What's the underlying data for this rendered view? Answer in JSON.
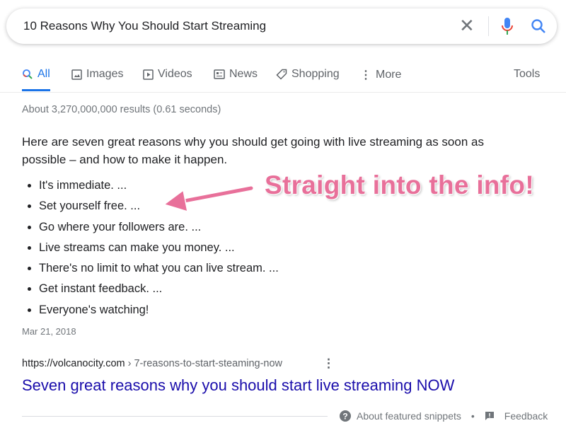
{
  "search": {
    "query": "10 Reasons Why You Should Start Streaming",
    "clear_icon": "close-icon",
    "voice_icon": "mic-icon",
    "search_icon": "search-icon"
  },
  "tabs": [
    {
      "label": "All",
      "icon": "search-icon",
      "active": true
    },
    {
      "label": "Images",
      "icon": "image-icon"
    },
    {
      "label": "Videos",
      "icon": "play-icon"
    },
    {
      "label": "News",
      "icon": "news-icon"
    },
    {
      "label": "Shopping",
      "icon": "tag-icon"
    },
    {
      "label": "More",
      "icon": "more-vert-icon"
    }
  ],
  "tools_label": "Tools",
  "stats": "About 3,270,000,000 results (0.61 seconds)",
  "snippet": {
    "intro": "Here are seven great reasons why you should get going with live streaming as soon as possible – and how to make it happen.",
    "items": [
      "It's immediate. ...",
      "Set yourself free. ...",
      "Go where your followers are. ...",
      "Live streams can make you money. ...",
      "There's no limit to what you can live stream. ...",
      "Get instant feedback. ...",
      "Everyone's watching!"
    ],
    "date": "Mar 21, 2018",
    "cite_domain": "https://volcanocity.com",
    "cite_path": " › 7-reasons-to-start-steaming-now",
    "title": "Seven great reasons why you should start live streaming NOW"
  },
  "footer": {
    "about": "About featured snippets",
    "separator": "•",
    "feedback": "Feedback"
  },
  "annotation": {
    "text": "Straight into the info!",
    "color": "#e8709a"
  },
  "colors": {
    "link": "#1a0dab",
    "accent": "#1a73e8"
  }
}
